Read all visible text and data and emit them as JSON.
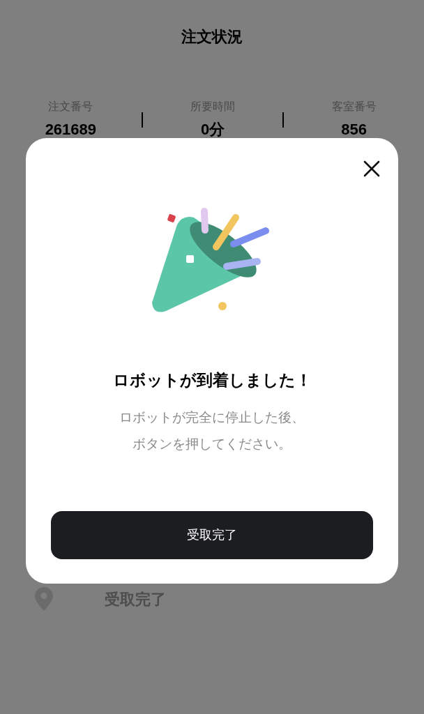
{
  "header": {
    "title": "注文状況"
  },
  "stats": [
    {
      "label": "注文番号",
      "value": "261689"
    },
    {
      "label": "所要時間",
      "value": "0分"
    },
    {
      "label": "客室番号",
      "value": "856"
    }
  ],
  "step": {
    "label": "受取完了"
  },
  "dialog": {
    "title": "ロボットが到着しました！",
    "message_lines": [
      "ロボットが完全に停止した後、",
      "ボタンを押してください。"
    ],
    "button": "受取完了"
  }
}
